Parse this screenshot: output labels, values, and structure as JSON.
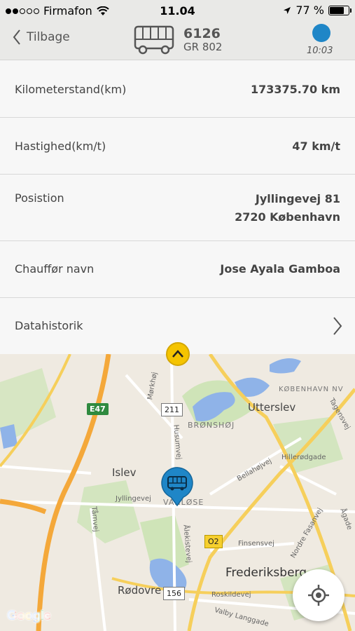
{
  "status_bar": {
    "carrier": "Firmafon",
    "time": "11.04",
    "battery": "77 %",
    "battery_level": 0.77,
    "signal_bars_filled": 2,
    "signal_bars_total": 5
  },
  "header": {
    "back_label": "Tilbage",
    "vehicle_number": "6126",
    "plate": "GR 802",
    "status_time": "10:03",
    "status_color": "#1f86c7"
  },
  "details": [
    {
      "label": "Kilometerstand(km)",
      "value": "173375.70 km"
    },
    {
      "label": "Hastighed(km/t)",
      "value": "47 km/t"
    },
    {
      "label": "Posistion",
      "value_line1": "Jyllingevej 81",
      "value_line2": "2720 København"
    },
    {
      "label": "Chauffør navn",
      "value": "Jose Ayala Gamboa"
    },
    {
      "label": "Datahistorik"
    }
  ],
  "map": {
    "labels": {
      "utterslev": "Utterslev",
      "bronshoj": "BRØNSHØJ",
      "kobenhavn_nv": "KØBENHAVN NV",
      "islev": "Islev",
      "vanlose": "VANLØSE",
      "frederiksberg": "Frederiksberg",
      "rodovre": "Rødovre",
      "morkhoj": "Mørkhøj",
      "husumvej": "Husumvej",
      "tagensvej": "Tagensvej",
      "bellahojvej": "Bellahøjvej",
      "hillerodgade": "Hillerødgade",
      "jyllingevej": "Jyllingevej",
      "tarnvej": "Tårnvej",
      "alekistevej": "Ålekistevej",
      "nordre_fasanvej": "Nordre Fasanvej",
      "finsensvej": "Finsensvej",
      "roskildevej": "Roskildevej",
      "valby_langgade": "Valby Langgade",
      "agade": "Ågade"
    },
    "road_shields": {
      "e47": "E47",
      "r211": "211",
      "o2": "O2",
      "r156": "156"
    },
    "logo": "Google"
  }
}
